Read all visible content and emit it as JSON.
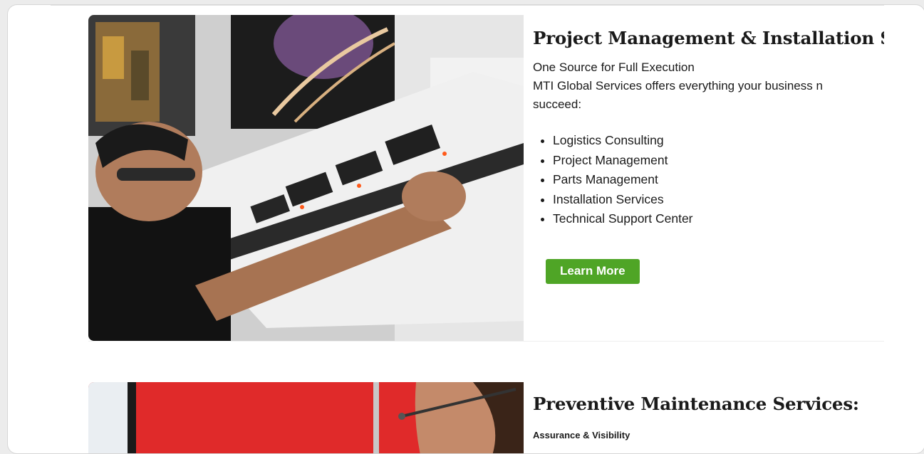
{
  "sections": [
    {
      "title": "Project Management & Installation Serv",
      "paragraph_lines": [
        "One Source for Full Execution",
        "MTI Global Services offers everything your business n",
        "succeed:"
      ],
      "list_items": [
        "Logistics Consulting",
        "Project Management",
        "Parts Management",
        "Installation Services",
        "Technical Support Center"
      ],
      "button_label": "Learn More"
    },
    {
      "title": "Preventive Maintenance Services:",
      "subtitle": "Assurance & Visibility"
    }
  ],
  "colors": {
    "button": "#4fa526",
    "text": "#1a1a1a"
  }
}
